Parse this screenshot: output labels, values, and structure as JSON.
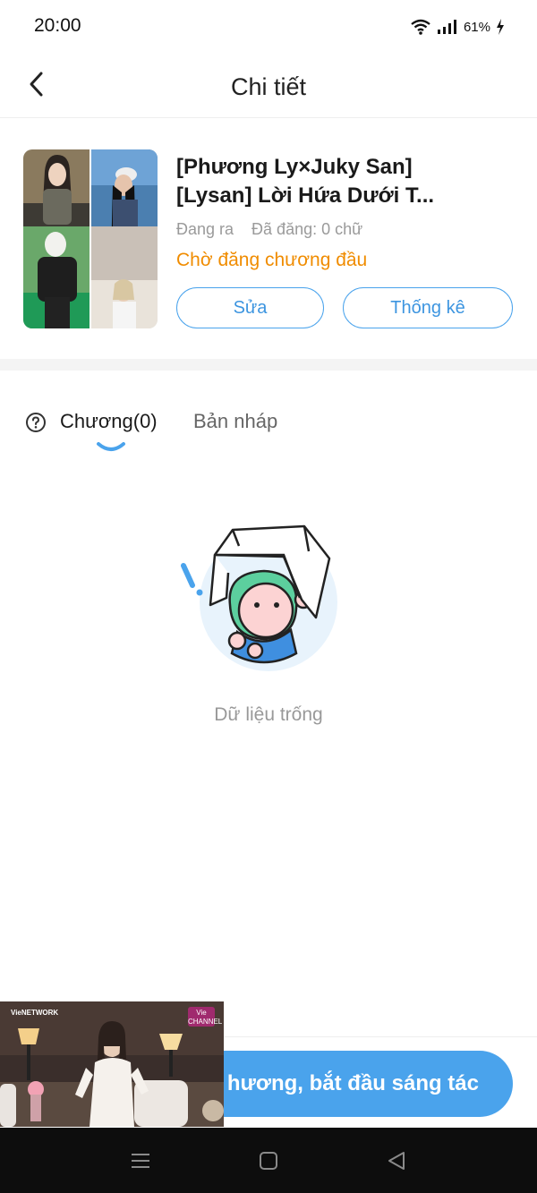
{
  "status_bar": {
    "time": "20:00",
    "battery": "61%"
  },
  "nav": {
    "title": "Chi tiết",
    "back_icon": "chevron-left-icon"
  },
  "book": {
    "title_line1": "[Phương Ly×Juky San]",
    "title_line2": "[Lysan] Lời Hứa Dưới T...",
    "status": "Đang ra",
    "published": "Đã đăng: 0 chữ",
    "waiting": "Chờ đăng chương đầu",
    "edit_label": "Sửa",
    "stats_label": "Thống kê"
  },
  "tabs": [
    {
      "label": "Chương(0)",
      "active": true
    },
    {
      "label": "Bản nháp",
      "active": false
    }
  ],
  "empty": {
    "text": "Dữ liệu trống"
  },
  "bottom": {
    "primary_label": "hương, bắt đầu sáng tác"
  },
  "pip": {
    "left_label": "VieNETWORK",
    "badge": "Vie CHANNEL"
  },
  "colors": {
    "accent": "#4aa3ec",
    "warning": "#f08c00",
    "muted": "#9a9a9a"
  }
}
